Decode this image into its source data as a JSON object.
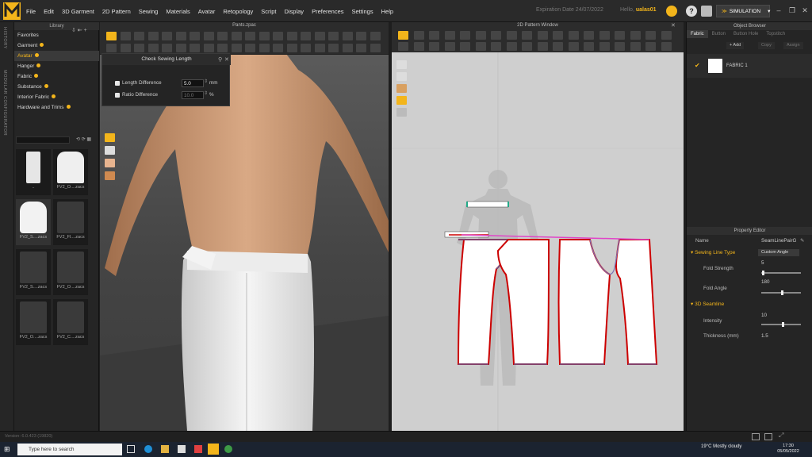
{
  "menu": [
    "File",
    "Edit",
    "3D Garment",
    "2D Pattern",
    "Sewing",
    "Materials",
    "Avatar",
    "Retopology",
    "Script",
    "Display",
    "Preferences",
    "Settings",
    "Help"
  ],
  "header": {
    "expiry": "Expiration Date 24/07/2022",
    "hello_prefix": "Hello,",
    "user": "ualas01",
    "sim_label": "SIMULATION"
  },
  "vstrip": {
    "history": "HISTORY",
    "modular": "MODULAR CONFIGURATOR"
  },
  "library": {
    "title": "Library",
    "items": [
      {
        "label": "Favorites"
      },
      {
        "label": "Garment"
      },
      {
        "label": "Avatar"
      },
      {
        "label": "Hanger"
      },
      {
        "label": "Fabric"
      },
      {
        "label": "Substance"
      },
      {
        "label": "Interior Fabric"
      },
      {
        "label": "Hardware and Trims"
      }
    ],
    "thumbs": [
      {
        "label": "..",
        "kind": "folder"
      },
      {
        "label": "FV2_O....zacs",
        "kind": "heel"
      },
      {
        "label": "FV2_S....zacs",
        "kind": "sneaker"
      },
      {
        "label": "FV2_Fl....zacs",
        "kind": "file"
      },
      {
        "label": "FV2_S....zacs",
        "kind": "file"
      },
      {
        "label": "FV2_O....zacs",
        "kind": "file"
      },
      {
        "label": "FV2_O....zacs",
        "kind": "file"
      },
      {
        "label": "FV2_C....zacs",
        "kind": "file"
      }
    ]
  },
  "viewport3d": {
    "title": "Pants.zpac"
  },
  "check_dialog": {
    "title": "Check Sewing Length",
    "length_label": "Length Difference",
    "length_value": "5.0",
    "length_unit": "mm",
    "ratio_label": "Ratio Difference",
    "ratio_value": "10.0",
    "ratio_unit": "%"
  },
  "viewport2d": {
    "title": "2D Pattern Window"
  },
  "object_browser": {
    "title": "Object Browser",
    "tabs": [
      "Fabric",
      "Button",
      "Button Hole",
      "Topstitch"
    ],
    "add": "+ Add",
    "copy": "Copy",
    "assign": "Assign",
    "fabric_name": "FABRIC 1"
  },
  "property_editor": {
    "title": "Property Editor",
    "name_label": "Name",
    "name_value": "SeamLinePairG",
    "sewing_section": "Sewing Line Type",
    "sewing_type": "Custom Angle",
    "fold_strength_label": "Fold Strength",
    "fold_strength": "5",
    "fold_angle_label": "Fold Angle",
    "fold_angle": "180",
    "seam_section": "3D Seamline",
    "intensity_label": "Intensity",
    "intensity": "10",
    "thickness_label": "Thickness (mm)",
    "thickness": "1.5"
  },
  "status": {
    "version": "Version: 6.0.423 (19820)"
  },
  "taskbar": {
    "search": "Type here to search",
    "weather": "19°C  Mostly cloudy",
    "time": "17:30",
    "date": "05/05/2022"
  }
}
